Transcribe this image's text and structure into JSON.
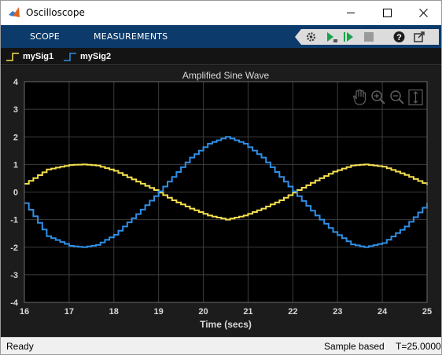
{
  "window": {
    "title": "Oscilloscope"
  },
  "toolstrip": {
    "tabs": [
      "SCOPE",
      "MEASUREMENTS"
    ],
    "tools": [
      "settings-icon",
      "step-forward-icon",
      "run-icon",
      "stop-icon",
      "help-icon",
      "undock-icon"
    ]
  },
  "legend": [
    {
      "label": "mySig1",
      "color": "#f5e04f"
    },
    {
      "label": "mySig2",
      "color": "#2f8fe6"
    }
  ],
  "status": {
    "ready": "Ready",
    "mode": "Sample based",
    "time": "T=25.0000"
  },
  "colors": {
    "toolstrip": "#0c3b6b",
    "plot_bg": "#1c1c1c",
    "axes_bg": "#000000",
    "grid": "#3c3c3c",
    "sig1": "#f5e04f",
    "sig2": "#2f8fe6"
  },
  "chart_data": {
    "type": "line",
    "step": true,
    "title": "Amplified Sine Wave",
    "xlabel": "Time (secs)",
    "ylabel": "",
    "xlim": [
      16,
      25
    ],
    "ylim": [
      -4,
      4
    ],
    "xticks": [
      "16",
      "17",
      "18",
      "19",
      "20",
      "21",
      "22",
      "23",
      "24",
      "25"
    ],
    "yticks": [
      "-4",
      "-3",
      "-2",
      "-1",
      "0",
      "1",
      "2",
      "3",
      "4"
    ],
    "grid": true,
    "axes_tools": [
      "pan-hand-icon",
      "zoom-in-icon",
      "zoom-out-icon",
      "autoscale-icon"
    ],
    "x": [
      16.0,
      16.5,
      17.0,
      17.3,
      17.6,
      18.0,
      18.5,
      18.9,
      19.3,
      19.7,
      20.1,
      20.5,
      20.9,
      21.3,
      21.7,
      22.1,
      22.5,
      22.9,
      23.3,
      23.6,
      24.0,
      24.5,
      25.0
    ],
    "series": [
      {
        "name": "mySig1",
        "color": "#f5e04f",
        "values": [
          0.3,
          0.82,
          0.98,
          1.0,
          0.96,
          0.77,
          0.38,
          0.07,
          -0.3,
          -0.6,
          -0.85,
          -1.0,
          -0.85,
          -0.6,
          -0.3,
          0.07,
          0.42,
          0.74,
          0.96,
          1.0,
          0.92,
          0.62,
          0.25
        ]
      },
      {
        "name": "mySig2",
        "color": "#2f8fe6",
        "values": [
          -0.4,
          -1.6,
          -1.95,
          -2.0,
          -1.92,
          -1.55,
          -0.8,
          -0.15,
          0.55,
          1.25,
          1.75,
          2.0,
          1.75,
          1.25,
          0.55,
          -0.15,
          -0.85,
          -1.45,
          -1.9,
          -2.0,
          -1.85,
          -1.25,
          -0.4
        ]
      }
    ]
  }
}
